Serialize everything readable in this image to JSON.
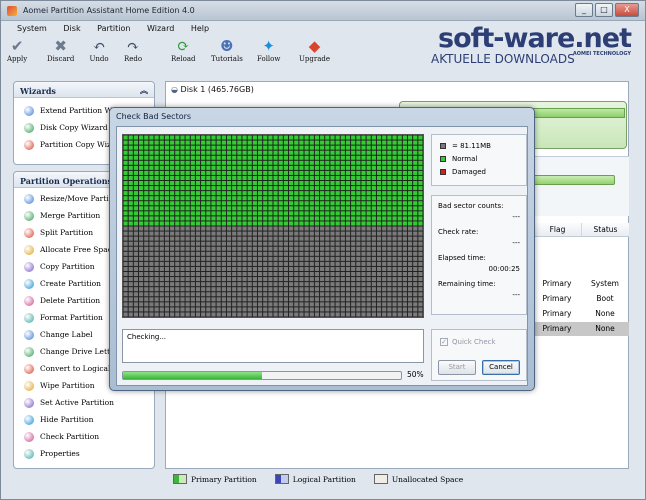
{
  "window": {
    "title": "Aomei Partition Assistant Home Edition 4.0",
    "controls": [
      "_",
      "□",
      "X"
    ]
  },
  "menu": [
    "System",
    "Disk",
    "Partition",
    "Wizard",
    "Help"
  ],
  "toolbar": [
    {
      "label": "Apply",
      "icon": "check-icon",
      "glyph": "✔",
      "color": "#6b7a8c"
    },
    {
      "label": "Discard",
      "icon": "discard-icon",
      "glyph": "✖",
      "color": "#6b7a8c"
    },
    {
      "label": "Undo",
      "icon": "undo-icon",
      "glyph": "↶",
      "color": "#3d4d60"
    },
    {
      "label": "Redo",
      "icon": "redo-icon",
      "glyph": "↷",
      "color": "#3d4d60"
    },
    {
      "label": "Reload",
      "icon": "reload-icon",
      "glyph": "⟳",
      "color": "#2f9b3a"
    },
    {
      "label": "Tutorials",
      "icon": "tutorials-icon",
      "glyph": "☻",
      "color": "#4a70b5"
    },
    {
      "label": "Follow",
      "icon": "follow-icon",
      "glyph": "✦",
      "color": "#1d8fd6"
    },
    {
      "label": "Upgrade",
      "icon": "upgrade-icon",
      "glyph": "◆",
      "color": "#d8442c"
    }
  ],
  "logo": {
    "main": "soft-ware.net",
    "sub": "AKTUELLE DOWNLOADS",
    "brand": "AOMEI TECHNOLOGY"
  },
  "wizards": {
    "title": "Wizards",
    "items": [
      "Extend Partition Wizard",
      "Disk Copy Wizard",
      "Partition Copy Wizard"
    ]
  },
  "operations": {
    "title": "Partition Operations",
    "items": [
      "Resize/Move Partition",
      "Merge Partition",
      "Split Partition",
      "Allocate Free Space",
      "Copy Partition",
      "Create Partition",
      "Delete Partition",
      "Format Partition",
      "Change Label",
      "Change Drive Letter",
      "Convert to Logical",
      "Wipe Partition",
      "Set Active Partition",
      "Hide Partition",
      "Check Partition",
      "Properties"
    ]
  },
  "disk": {
    "label": "Disk 1 (465.76GB)"
  },
  "table": {
    "headers": [
      "Flag",
      "Status"
    ],
    "rows": [
      [
        "Primary",
        "System"
      ],
      [
        "Primary",
        "Boot"
      ],
      [
        "Primary",
        "None"
      ],
      [
        "Primary",
        "None"
      ]
    ]
  },
  "legend": [
    "Primary Partition",
    "Logical Partition",
    "Unallocated Space"
  ],
  "dialog": {
    "title": "Check Bad Sectors",
    "block_size": "= 81.11MB",
    "legend_normal": "Normal",
    "legend_damaged": "Damaged",
    "bad_sector_label": "Bad sector counts:",
    "bad_sector_value": "---",
    "check_rate_label": "Check rate:",
    "check_rate_value": "---",
    "elapsed_label": "Elapsed time:",
    "elapsed_value": "00:00:25",
    "remaining_label": "Remaining time:",
    "remaining_value": "---",
    "log": "Checking...",
    "progress": 0.5,
    "progress_label": "50%",
    "quick_check": "Quick Check",
    "start": "Start",
    "cancel": "Cancel",
    "grid_cols": 58,
    "grid_rows": 36,
    "checked_rows": 18
  },
  "colors": {
    "normal": "#33cc33",
    "unchecked": "#7a7a7a",
    "damaged": "#cc2222",
    "accent": "#2d3e74"
  }
}
